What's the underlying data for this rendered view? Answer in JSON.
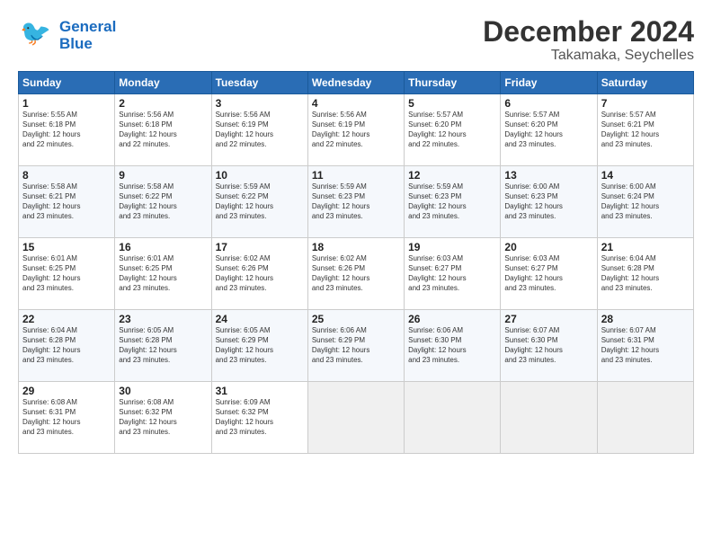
{
  "logo": {
    "line1": "General",
    "line2": "Blue"
  },
  "calendar": {
    "title": "December 2024",
    "location": "Takamaka, Seychelles",
    "days_of_week": [
      "Sunday",
      "Monday",
      "Tuesday",
      "Wednesday",
      "Thursday",
      "Friday",
      "Saturday"
    ],
    "weeks": [
      [
        {
          "day": "",
          "info": ""
        },
        {
          "day": "2",
          "info": "Sunrise: 5:56 AM\nSunset: 6:18 PM\nDaylight: 12 hours\nand 22 minutes."
        },
        {
          "day": "3",
          "info": "Sunrise: 5:56 AM\nSunset: 6:19 PM\nDaylight: 12 hours\nand 22 minutes."
        },
        {
          "day": "4",
          "info": "Sunrise: 5:56 AM\nSunset: 6:19 PM\nDaylight: 12 hours\nand 22 minutes."
        },
        {
          "day": "5",
          "info": "Sunrise: 5:57 AM\nSunset: 6:20 PM\nDaylight: 12 hours\nand 22 minutes."
        },
        {
          "day": "6",
          "info": "Sunrise: 5:57 AM\nSunset: 6:20 PM\nDaylight: 12 hours\nand 23 minutes."
        },
        {
          "day": "7",
          "info": "Sunrise: 5:57 AM\nSunset: 6:21 PM\nDaylight: 12 hours\nand 23 minutes."
        }
      ],
      [
        {
          "day": "8",
          "info": "Sunrise: 5:58 AM\nSunset: 6:21 PM\nDaylight: 12 hours\nand 23 minutes."
        },
        {
          "day": "9",
          "info": "Sunrise: 5:58 AM\nSunset: 6:22 PM\nDaylight: 12 hours\nand 23 minutes."
        },
        {
          "day": "10",
          "info": "Sunrise: 5:59 AM\nSunset: 6:22 PM\nDaylight: 12 hours\nand 23 minutes."
        },
        {
          "day": "11",
          "info": "Sunrise: 5:59 AM\nSunset: 6:23 PM\nDaylight: 12 hours\nand 23 minutes."
        },
        {
          "day": "12",
          "info": "Sunrise: 5:59 AM\nSunset: 6:23 PM\nDaylight: 12 hours\nand 23 minutes."
        },
        {
          "day": "13",
          "info": "Sunrise: 6:00 AM\nSunset: 6:23 PM\nDaylight: 12 hours\nand 23 minutes."
        },
        {
          "day": "14",
          "info": "Sunrise: 6:00 AM\nSunset: 6:24 PM\nDaylight: 12 hours\nand 23 minutes."
        }
      ],
      [
        {
          "day": "15",
          "info": "Sunrise: 6:01 AM\nSunset: 6:25 PM\nDaylight: 12 hours\nand 23 minutes."
        },
        {
          "day": "16",
          "info": "Sunrise: 6:01 AM\nSunset: 6:25 PM\nDaylight: 12 hours\nand 23 minutes."
        },
        {
          "day": "17",
          "info": "Sunrise: 6:02 AM\nSunset: 6:26 PM\nDaylight: 12 hours\nand 23 minutes."
        },
        {
          "day": "18",
          "info": "Sunrise: 6:02 AM\nSunset: 6:26 PM\nDaylight: 12 hours\nand 23 minutes."
        },
        {
          "day": "19",
          "info": "Sunrise: 6:03 AM\nSunset: 6:27 PM\nDaylight: 12 hours\nand 23 minutes."
        },
        {
          "day": "20",
          "info": "Sunrise: 6:03 AM\nSunset: 6:27 PM\nDaylight: 12 hours\nand 23 minutes."
        },
        {
          "day": "21",
          "info": "Sunrise: 6:04 AM\nSunset: 6:28 PM\nDaylight: 12 hours\nand 23 minutes."
        }
      ],
      [
        {
          "day": "22",
          "info": "Sunrise: 6:04 AM\nSunset: 6:28 PM\nDaylight: 12 hours\nand 23 minutes."
        },
        {
          "day": "23",
          "info": "Sunrise: 6:05 AM\nSunset: 6:28 PM\nDaylight: 12 hours\nand 23 minutes."
        },
        {
          "day": "24",
          "info": "Sunrise: 6:05 AM\nSunset: 6:29 PM\nDaylight: 12 hours\nand 23 minutes."
        },
        {
          "day": "25",
          "info": "Sunrise: 6:06 AM\nSunset: 6:29 PM\nDaylight: 12 hours\nand 23 minutes."
        },
        {
          "day": "26",
          "info": "Sunrise: 6:06 AM\nSunset: 6:30 PM\nDaylight: 12 hours\nand 23 minutes."
        },
        {
          "day": "27",
          "info": "Sunrise: 6:07 AM\nSunset: 6:30 PM\nDaylight: 12 hours\nand 23 minutes."
        },
        {
          "day": "28",
          "info": "Sunrise: 6:07 AM\nSunset: 6:31 PM\nDaylight: 12 hours\nand 23 minutes."
        }
      ],
      [
        {
          "day": "29",
          "info": "Sunrise: 6:08 AM\nSunset: 6:31 PM\nDaylight: 12 hours\nand 23 minutes."
        },
        {
          "day": "30",
          "info": "Sunrise: 6:08 AM\nSunset: 6:32 PM\nDaylight: 12 hours\nand 23 minutes."
        },
        {
          "day": "31",
          "info": "Sunrise: 6:09 AM\nSunset: 6:32 PM\nDaylight: 12 hours\nand 23 minutes."
        },
        {
          "day": "",
          "info": ""
        },
        {
          "day": "",
          "info": ""
        },
        {
          "day": "",
          "info": ""
        },
        {
          "day": "",
          "info": ""
        }
      ]
    ],
    "week1_day1": {
      "day": "1",
      "info": "Sunrise: 5:55 AM\nSunset: 6:18 PM\nDaylight: 12 hours\nand 22 minutes."
    }
  }
}
